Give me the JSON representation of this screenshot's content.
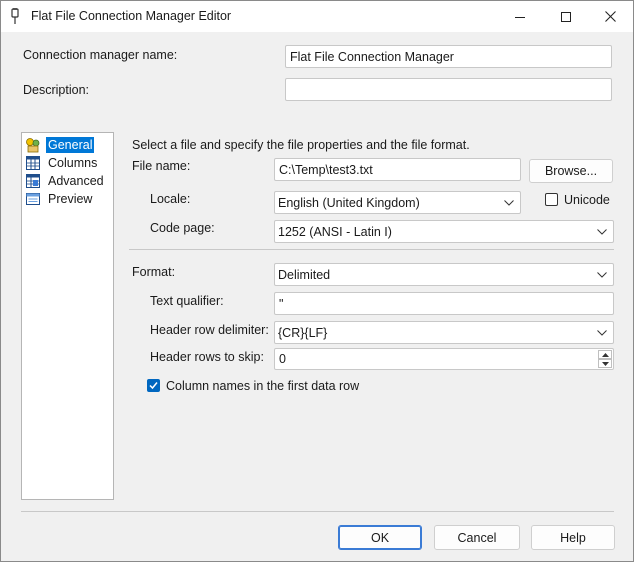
{
  "window": {
    "title": "Flat File Connection Manager Editor"
  },
  "header": {
    "connection_manager_name_label": "Connection manager name:",
    "connection_manager_name_value": "Flat File Connection Manager",
    "description_label": "Description:",
    "description_value": ""
  },
  "nav": {
    "items": [
      {
        "label": "General",
        "icon": "general-icon",
        "selected": true
      },
      {
        "label": "Columns",
        "icon": "columns-icon",
        "selected": false
      },
      {
        "label": "Advanced",
        "icon": "advanced-icon",
        "selected": false
      },
      {
        "label": "Preview",
        "icon": "preview-icon",
        "selected": false
      }
    ]
  },
  "general": {
    "intro": "Select a file and specify the file properties and the file format.",
    "file_name_label": "File name:",
    "file_name_value": "C:\\Temp\\test3.txt",
    "browse_label": "Browse...",
    "locale_label": "Locale:",
    "locale_value": "English (United Kingdom)",
    "unicode_label": "Unicode",
    "unicode_checked": false,
    "code_page_label": "Code page:",
    "code_page_value": "1252  (ANSI - Latin I)",
    "format_label": "Format:",
    "format_value": "Delimited",
    "text_qualifier_label": "Text qualifier:",
    "text_qualifier_value": "\"",
    "header_row_delimiter_label": "Header row delimiter:",
    "header_row_delimiter_value": "{CR}{LF}",
    "header_rows_to_skip_label": "Header rows to skip:",
    "header_rows_to_skip_value": "0",
    "column_names_label": "Column names in the first data row",
    "column_names_checked": true
  },
  "footer": {
    "ok_label": "OK",
    "cancel_label": "Cancel",
    "help_label": "Help"
  },
  "colors": {
    "accent": "#0078d7",
    "checkbox": "#0067c0",
    "window_bg": "#f0f0f0"
  }
}
